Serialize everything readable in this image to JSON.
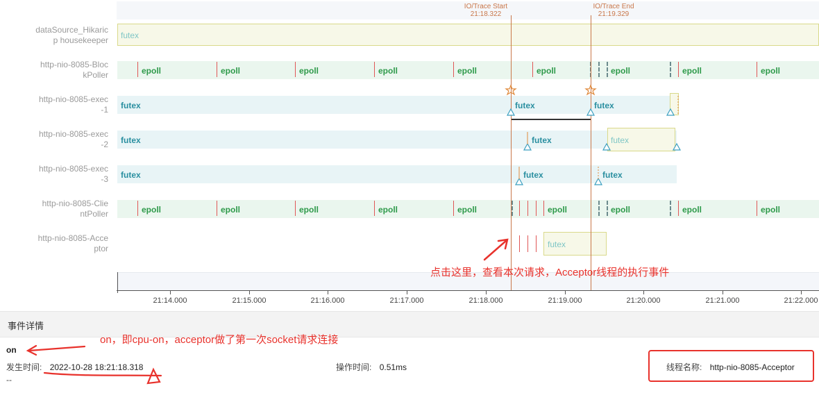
{
  "timeline": {
    "markers": [
      {
        "label": "IO/Trace Start",
        "time": "21:18.322"
      },
      {
        "label": "IO/Trace End",
        "time": "21:19.329"
      }
    ],
    "threads": [
      {
        "name": "dataSource_Hikaric\np housekeeper",
        "events": [
          "futex"
        ]
      },
      {
        "name": "http-nio-8085-Bloc\nkPoller",
        "events": [
          "epoll",
          "epoll",
          "epoll",
          "epoll",
          "epoll",
          "epoll",
          "epoll",
          "epoll",
          "epoll"
        ]
      },
      {
        "name": "http-nio-8085-exec\n-1",
        "events": [
          "futex",
          "futex",
          "futex"
        ]
      },
      {
        "name": "http-nio-8085-exec\n-2",
        "events": [
          "futex",
          "futex",
          "futex"
        ]
      },
      {
        "name": "http-nio-8085-exec\n-3",
        "events": [
          "futex",
          "futex",
          "futex"
        ]
      },
      {
        "name": "http-nio-8085-Clie\nntPoller",
        "events": [
          "epoll",
          "epoll",
          "epoll",
          "epoll",
          "epoll",
          "epoll",
          "epoll",
          "epoll",
          "epoll"
        ]
      },
      {
        "name": "http-nio-8085-Acce\nptor",
        "events": [
          "futex"
        ]
      }
    ],
    "axis_ticks": [
      "21:14.000",
      "21:15.000",
      "21:16.000",
      "21:17.000",
      "21:18.000",
      "21:19.000",
      "21:20.000",
      "21:21.000",
      "21:22.000"
    ]
  },
  "annotations": {
    "click_hint": "点击这里，查看本次请求，Acceptor线程的执行事件",
    "on_hint": "on，即cpu-on，acceptor做了第一次socket请求连接"
  },
  "details": {
    "header": "事件详情",
    "event_name": "on",
    "occur_label": "发生时间:",
    "occur_value": "2022-10-28 18:21:18.318",
    "duration_label": "操作时间:",
    "duration_value": "0.51ms",
    "thread_label": "线程名称:",
    "thread_value": "http-nio-8085-Acceptor",
    "extra": "--"
  },
  "colors": {
    "futex_text": "#2a8fa0",
    "epoll_text": "#2e9a4a",
    "marker": "#c9774a",
    "annotation": "#e8322c"
  }
}
